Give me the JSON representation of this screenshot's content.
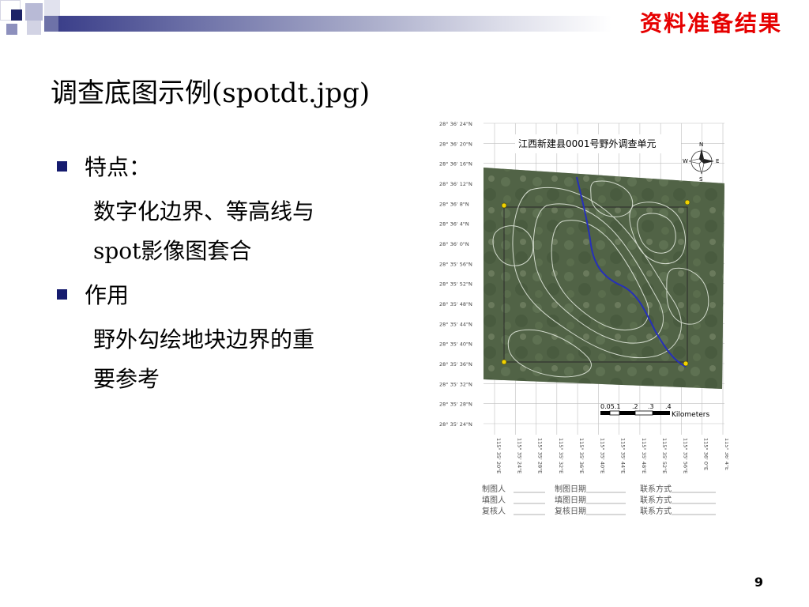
{
  "header": {
    "section_title": "资料准备结果"
  },
  "slide": {
    "title": "调查底图示例(spotdt.jpg)",
    "bullets": [
      {
        "label": "特点：",
        "lines": [
          "数字化边界、等高线与",
          "spot影像图套合"
        ]
      },
      {
        "label": "作用",
        "lines": [
          "野外勾绘地块边界的重",
          "要参考"
        ]
      }
    ],
    "page_number": "9"
  },
  "map": {
    "title": "江西新建县0001号野外调查单元",
    "lat_labels": [
      "28° 36' 24\"N",
      "28° 36' 20\"N",
      "28° 36' 16\"N",
      "28° 36' 12\"N",
      "28° 36' 8\"N",
      "28° 36' 4\"N",
      "28° 36' 0\"N",
      "28° 35' 56\"N",
      "28° 35' 52\"N",
      "28° 35' 48\"N",
      "28° 35' 44\"N",
      "28° 35' 40\"N",
      "28° 35' 36\"N",
      "28° 35' 32\"N",
      "28° 35' 28\"N",
      "28° 35' 24\"N"
    ],
    "lon_labels": [
      "115° 35' 20\"E",
      "115° 35' 24\"E",
      "115° 35' 28\"E",
      "115° 35' 32\"E",
      "115° 35' 36\"E",
      "115° 35' 40\"E",
      "115° 35' 44\"E",
      "115° 35' 48\"E",
      "115° 35' 52\"E",
      "115° 35' 56\"E",
      "115° 36' 0\"E",
      "115° 36' 4\"E"
    ],
    "scale_labels": [
      "0.05.1",
      ".2",
      ".3",
      ".4"
    ],
    "scale_unit": "Kilometers",
    "compass": {
      "n": "N",
      "s": "S",
      "e": "E",
      "w": "W"
    },
    "signature_rows": [
      [
        "制图人",
        "制图日期",
        "联系方式"
      ],
      [
        "填图人",
        "填图日期",
        "联系方式"
      ],
      [
        "复核人",
        "复核日期",
        "联系方式"
      ]
    ],
    "colors": {
      "imagery": "#55674a",
      "contour": "#e9efe4",
      "river": "#2630b8",
      "marker": "#f2d200",
      "grid": "#bfbfbf"
    }
  }
}
